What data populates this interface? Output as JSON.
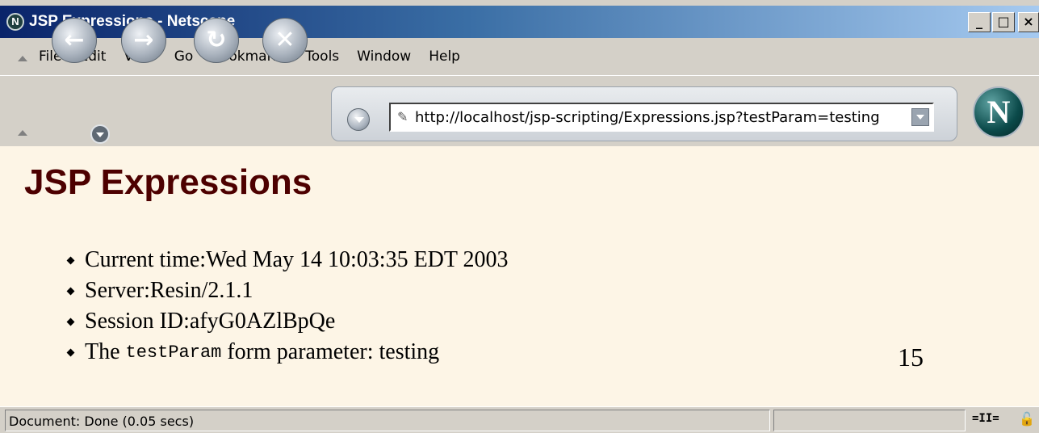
{
  "window": {
    "title": "JSP Expressions - Netscape",
    "title_icon": "N",
    "controls": {
      "minimize": "_",
      "maximize": "□",
      "close": "×"
    }
  },
  "menu": {
    "items": [
      {
        "label": "File",
        "icon": ""
      },
      {
        "label": "Edit"
      },
      {
        "label": "View"
      },
      {
        "label": "Go"
      },
      {
        "label": "Bookmarks"
      },
      {
        "label": "Tools"
      },
      {
        "label": "Window"
      },
      {
        "label": "Help"
      }
    ]
  },
  "toolbar": {
    "back_icon": "back-arrow-icon",
    "forward_icon": "forward-arrow-icon",
    "reload_icon": "reload-icon",
    "stop_icon": "stop-icon",
    "address": "http://localhost/jsp-scripting/Expressions.jsp?testParam=testing",
    "logo": "N"
  },
  "content": {
    "heading": "JSP Expressions",
    "items": [
      {
        "label": "Current time: ",
        "value": "Wed May 14 10:03:35 EDT 2003"
      },
      {
        "label": "Server: ",
        "value": "Resin/2.1.1"
      },
      {
        "label": "Session ID: ",
        "value": "afyG0AZlBpQe"
      },
      {
        "label": "The ",
        "code": "testParam",
        "suffix": " form parameter: ",
        "value": "testing"
      }
    ],
    "page_number": "15"
  },
  "status": {
    "text": "Document: Done (0.05 secs)",
    "connection_icon": "connection-icon",
    "lock_icon": "lock-icon"
  },
  "colors": {
    "heading": "#4d0000",
    "page_background": "#fdf5e6",
    "chrome": "#d4d0c8",
    "titlebar_start": "#0a246a"
  }
}
